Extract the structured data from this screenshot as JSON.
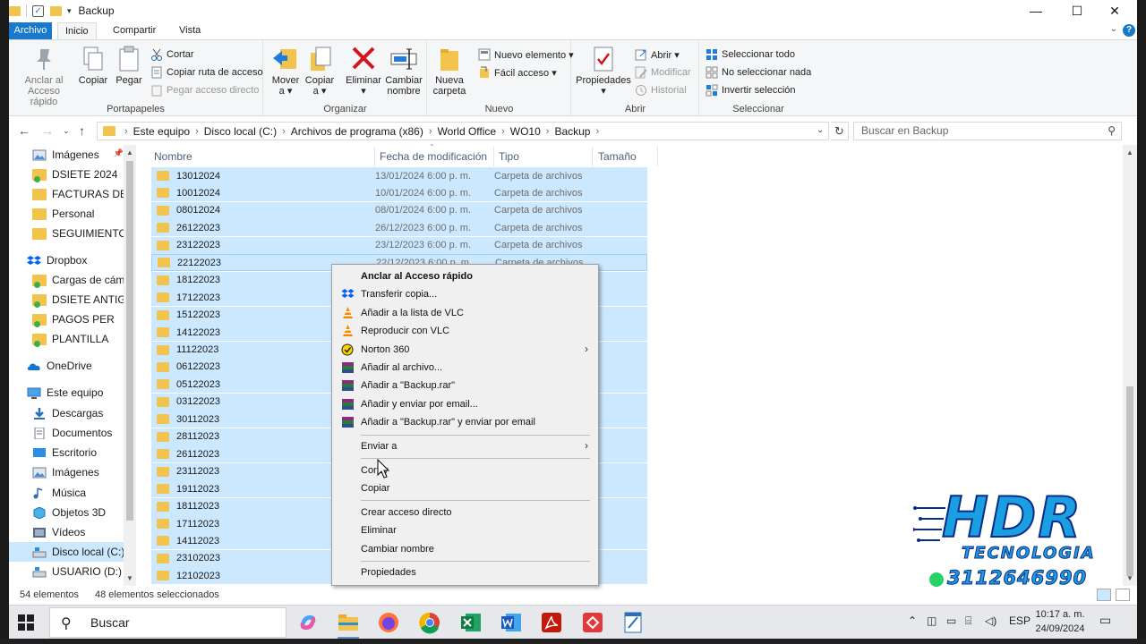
{
  "window": {
    "title": "Backup",
    "controls": {
      "minimize": "—",
      "maximize": "☐",
      "close": "✕"
    }
  },
  "ribbon_tabs": [
    {
      "label": "Archivo"
    },
    {
      "label": "Inicio"
    },
    {
      "label": "Compartir"
    },
    {
      "label": "Vista"
    }
  ],
  "ribbon": {
    "portapapeles": {
      "label": "Portapapeles",
      "pin_label_1": "Anclar al",
      "pin_label_2": "Acceso rápido",
      "copy": "Copiar",
      "paste": "Pegar",
      "cut": "Cortar",
      "copy_path": "Copiar ruta de acceso",
      "paste_shortcut": "Pegar acceso directo"
    },
    "organizar": {
      "label": "Organizar",
      "move_1": "Mover",
      "move_2": "a ▾",
      "copyto_1": "Copiar",
      "copyto_2": "a ▾",
      "delete_1": "Eliminar",
      "delete_2": "▾",
      "rename_1": "Cambiar",
      "rename_2": "nombre"
    },
    "nuevo": {
      "label": "Nuevo",
      "new_folder_1": "Nueva",
      "new_folder_2": "carpeta",
      "new_item": "Nuevo elemento ▾",
      "easy_access": "Fácil acceso ▾"
    },
    "abrir": {
      "label": "Abrir",
      "properties_1": "Propiedades",
      "properties_2": "▾",
      "open": "Abrir ▾",
      "edit": "Modificar",
      "history": "Historial"
    },
    "seleccionar": {
      "label": "Seleccionar",
      "select_all": "Seleccionar todo",
      "select_none": "No seleccionar nada",
      "invert": "Invertir selección"
    }
  },
  "address": {
    "crumbs": [
      "Este equipo",
      "Disco local (C:)",
      "Archivos de programa (x86)",
      "World Office",
      "WO10",
      "Backup"
    ],
    "search_placeholder": "Buscar en Backup"
  },
  "nav_pane": [
    {
      "label": "Imágenes",
      "icon": "pictures-icon",
      "pinned": true
    },
    {
      "label": "DSIETE 2024",
      "icon": "folder-sync-icon"
    },
    {
      "label": "FACTURAS DE VE",
      "icon": "folder-icon"
    },
    {
      "label": "Personal",
      "icon": "folder-icon"
    },
    {
      "label": "SEGUIMIENTO PI",
      "icon": "folder-icon"
    },
    {
      "label": "Dropbox",
      "icon": "dropbox-icon"
    },
    {
      "label": "Cargas de cámar",
      "icon": "folder-sync-icon"
    },
    {
      "label": "DSIETE ANTIGUA",
      "icon": "folder-sync-icon"
    },
    {
      "label": "PAGOS PER",
      "icon": "folder-sync-icon"
    },
    {
      "label": "PLANTILLA",
      "icon": "folder-sync-icon"
    },
    {
      "label": "OneDrive",
      "icon": "onedrive-icon"
    },
    {
      "label": "Este equipo",
      "icon": "computer-icon"
    },
    {
      "label": "Descargas",
      "icon": "downloads-icon"
    },
    {
      "label": "Documentos",
      "icon": "documents-icon"
    },
    {
      "label": "Escritorio",
      "icon": "desktop-icon"
    },
    {
      "label": "Imágenes",
      "icon": "pictures-icon"
    },
    {
      "label": "Música",
      "icon": "music-icon"
    },
    {
      "label": "Objetos 3D",
      "icon": "3d-objects-icon"
    },
    {
      "label": "Vídeos",
      "icon": "videos-icon"
    },
    {
      "label": "Disco local (C:)",
      "icon": "drive-icon",
      "selected": true
    },
    {
      "label": "USUARIO (D:)",
      "icon": "drive-icon"
    }
  ],
  "columns": {
    "name": "Nombre",
    "date": "Fecha de modificación",
    "type": "Tipo",
    "size": "Tamaño"
  },
  "files": [
    {
      "name": "13012024",
      "date": "13/01/2024 6:00 p. m.",
      "type": "Carpeta de archivos"
    },
    {
      "name": "10012024",
      "date": "10/01/2024 6:00 p. m.",
      "type": "Carpeta de archivos"
    },
    {
      "name": "08012024",
      "date": "08/01/2024 6:00 p. m.",
      "type": "Carpeta de archivos"
    },
    {
      "name": "26122023",
      "date": "26/12/2023 6:00 p. m.",
      "type": "Carpeta de archivos"
    },
    {
      "name": "23122023",
      "date": "23/12/2023 6:00 p. m.",
      "type": "Carpeta de archivos"
    },
    {
      "name": "22122023",
      "date": "22/12/2023 6:00 p. m.",
      "type": "Carpeta de archivos"
    },
    {
      "name": "18122023",
      "date": "",
      "type": ""
    },
    {
      "name": "17122023",
      "date": "",
      "type": ""
    },
    {
      "name": "15122023",
      "date": "",
      "type": ""
    },
    {
      "name": "14122023",
      "date": "",
      "type": ""
    },
    {
      "name": "11122023",
      "date": "",
      "type": ""
    },
    {
      "name": "06122023",
      "date": "",
      "type": ""
    },
    {
      "name": "05122023",
      "date": "",
      "type": ""
    },
    {
      "name": "03122023",
      "date": "",
      "type": ""
    },
    {
      "name": "30112023",
      "date": "",
      "type": ""
    },
    {
      "name": "28112023",
      "date": "",
      "type": ""
    },
    {
      "name": "26112023",
      "date": "",
      "type": ""
    },
    {
      "name": "23112023",
      "date": "",
      "type": ""
    },
    {
      "name": "19112023",
      "date": "",
      "type": ""
    },
    {
      "name": "18112023",
      "date": "",
      "type": ""
    },
    {
      "name": "17112023",
      "date": "",
      "type": ""
    },
    {
      "name": "14112023",
      "date": "",
      "type": ""
    },
    {
      "name": "23102023",
      "date": "",
      "type": ""
    },
    {
      "name": "12102023",
      "date": "",
      "type": ""
    }
  ],
  "status": {
    "count": "54 elementos",
    "selected": "48 elementos seleccionados"
  },
  "context_menu": {
    "pin": "Anclar al Acceso rápido",
    "dropbox": "Transferir copia...",
    "vlc_add": "Añadir a la lista de VLC",
    "vlc_play": "Reproducir con VLC",
    "norton": "Norton 360",
    "rar_add": "Añadir al archivo...",
    "rar_backup": "Añadir a \"Backup.rar\"",
    "rar_email": "Añadir y enviar por email...",
    "rar_backup_email": "Añadir a \"Backup.rar\" y enviar por email",
    "send_to": "Enviar a",
    "cut": "Cortar",
    "copy": "Copiar",
    "shortcut": "Crear acceso directo",
    "delete": "Eliminar",
    "rename": "Cambiar nombre",
    "properties": "Propiedades"
  },
  "taskbar": {
    "search": "Buscar",
    "language": "ESP",
    "time": "10:17 a. m.",
    "date": "24/09/2024"
  },
  "watermark": {
    "brand": "HDR",
    "sub": "TECNOLOGIA",
    "phone": "3112646990"
  },
  "colors": {
    "accent": "#1979ca",
    "selection": "#cce8ff",
    "folder": "#f3c44d"
  }
}
